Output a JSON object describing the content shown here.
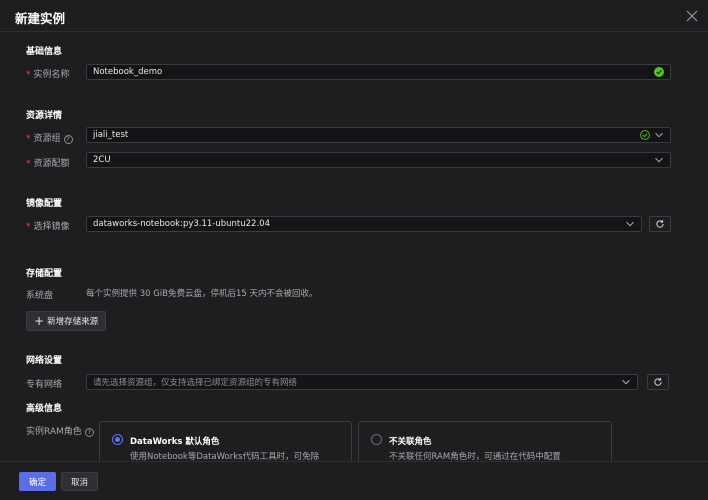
{
  "dialog": {
    "title": "新建实例"
  },
  "basic": {
    "section": "基础信息",
    "name_label": "实例名称",
    "name_value": "Notebook_demo"
  },
  "resource": {
    "section": "资源详情",
    "group_label": "资源组",
    "group_value": "jiali_test",
    "quota_label": "资源配额",
    "quota_value": "2CU"
  },
  "image": {
    "section": "镜像配置",
    "select_label": "选择镜像",
    "select_value": "dataworks-notebook:py3.11-ubuntu22.04"
  },
  "storage": {
    "section": "存储配置",
    "disk_label": "系统盘",
    "disk_desc": "每个实例提供 30 GiB免费云盘，停机后15 天内不会被回收。",
    "add_label": "新增存储来源"
  },
  "network": {
    "section": "网络设置",
    "vpc_label": "专有网络",
    "vpc_placeholder": "请先选择资源组，仅支持选择已绑定资源组的专有网络"
  },
  "advanced": {
    "section": "高级信息",
    "ram_label": "实例RAM角色",
    "option_default_title": "DataWorks 默认角色",
    "option_default_desc": "使用Notebook等DataWorks代码工具时，可免除",
    "option_none_title": "不关联角色",
    "option_none_desc": "不关联任何RAM角色时，可通过在代码中配置"
  },
  "footer": {
    "ok_label": "确定",
    "cancel_label": "取消"
  },
  "icons": {
    "check": "check-circle-icon",
    "dropdown": "chevron-down-icon",
    "refresh": "refresh-icon",
    "help": "help-icon",
    "close": "close-icon",
    "plus": "plus-icon"
  },
  "colors": {
    "accent": "#5b6ee8",
    "success": "#52c41a",
    "required": "#e5484d"
  }
}
